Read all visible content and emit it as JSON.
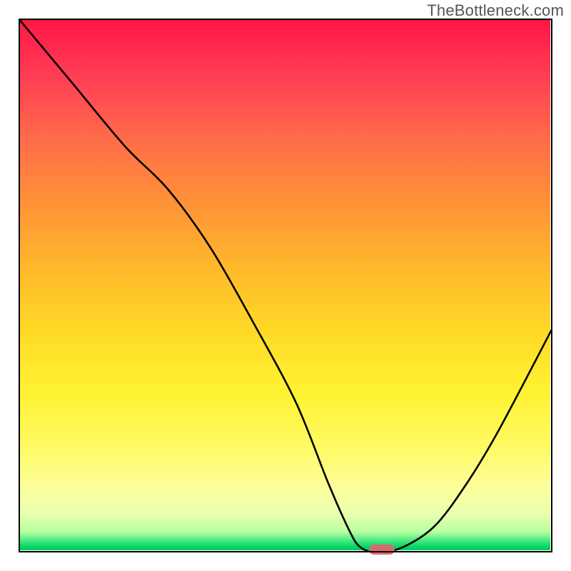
{
  "watermark": "TheBottleneck.com",
  "chart_data": {
    "type": "line",
    "title": "",
    "xlabel": "",
    "ylabel": "",
    "xlim": [
      0,
      100
    ],
    "ylim": [
      0,
      100
    ],
    "x": [
      0,
      10,
      20,
      28,
      36,
      44,
      52,
      58,
      62,
      64,
      67,
      72,
      78,
      84,
      90,
      100
    ],
    "values": [
      100,
      88,
      76,
      68,
      57,
      43,
      28,
      13,
      4,
      1,
      0,
      1,
      5,
      13,
      23,
      42
    ],
    "marker": {
      "x": 68,
      "y": 0.5
    },
    "background_scale": "bottleneck-gradient"
  }
}
